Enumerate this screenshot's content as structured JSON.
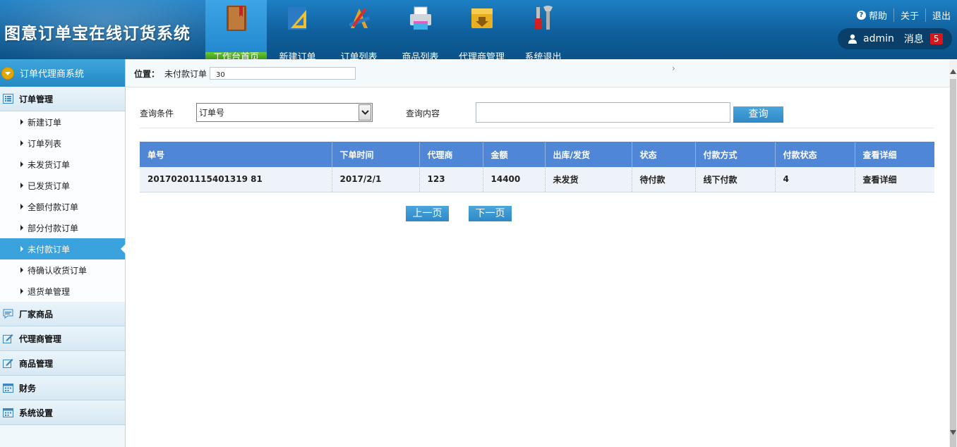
{
  "app": {
    "title": "图意订单宝在线订货系统"
  },
  "nav": [
    {
      "label": "工作台首页",
      "icon": "book-icon",
      "active": true
    },
    {
      "label": "新建订单",
      "icon": "ruler-icon",
      "active": false
    },
    {
      "label": "订单列表",
      "icon": "drafting-tools-icon",
      "active": false
    },
    {
      "label": "商品列表",
      "icon": "printer-icon",
      "active": false
    },
    {
      "label": "代理商管理",
      "icon": "download-box-icon",
      "active": false
    },
    {
      "label": "系统退出",
      "icon": "tools-icon",
      "active": false
    }
  ],
  "top_links": {
    "help": "帮助",
    "about": "关于",
    "logout": "退出"
  },
  "user": {
    "name": "admin",
    "messages_label": "消息",
    "messages_count": "5"
  },
  "sidebar": {
    "title": "订单代理商系统",
    "order_group": {
      "label": "订单管理",
      "items": [
        {
          "label": "新建订单",
          "active": false
        },
        {
          "label": "订单列表",
          "active": false
        },
        {
          "label": "未发货订单",
          "active": false
        },
        {
          "label": "已发货订单",
          "active": false
        },
        {
          "label": "全额付款订单",
          "active": false
        },
        {
          "label": "部分付款订单",
          "active": false
        },
        {
          "label": "未付款订单",
          "active": true
        },
        {
          "label": "待确认收货订单",
          "active": false
        },
        {
          "label": "退货单管理",
          "active": false
        }
      ]
    },
    "groups": [
      {
        "label": "厂家商品",
        "icon": "chat-icon"
      },
      {
        "label": "代理商管理",
        "icon": "edit-icon"
      },
      {
        "label": "商品管理",
        "icon": "edit-icon"
      },
      {
        "label": "财务",
        "icon": "calendar-icon"
      },
      {
        "label": "系统设置",
        "icon": "calendar-icon"
      }
    ]
  },
  "breadcrumb": {
    "label": "位置：",
    "value": "未付款订单",
    "input_value": "30",
    "chevron": "›"
  },
  "filter": {
    "condition_label": "查询条件",
    "condition_value": "订单号",
    "content_label": "查询内容",
    "content_value": "",
    "search_button": "查询"
  },
  "table": {
    "columns": [
      "单号",
      "下单时间",
      "代理商",
      "金额",
      "出库/发货",
      "状态",
      "付款方式",
      "付款状态",
      "查看详细"
    ],
    "rows": [
      [
        "20170201115401319 81",
        "2017/2/1",
        "123",
        "14400",
        "未发货",
        "待付款",
        "线下付款",
        "4",
        "查看详细"
      ]
    ]
  },
  "pagination": {
    "prev": "上一页",
    "next": "下一页"
  },
  "colors": {
    "header": "#0f5f9c",
    "accent": "#3aa2dc",
    "table_header": "#4f86d6",
    "badge": "#d9161c"
  }
}
